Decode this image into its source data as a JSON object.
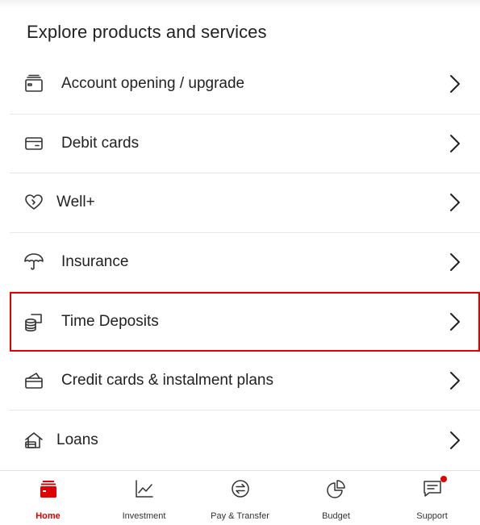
{
  "section": {
    "title": "Explore products and services"
  },
  "menu": {
    "items": [
      {
        "label": "Account opening / upgrade",
        "icon": "wallet-icon"
      },
      {
        "label": "Debit cards",
        "icon": "card-icon"
      },
      {
        "label": "Well+",
        "icon": "heart-icon"
      },
      {
        "label": "Insurance",
        "icon": "umbrella-icon"
      },
      {
        "label": "Time Deposits",
        "icon": "coins-icon",
        "highlighted": true
      },
      {
        "label": "Credit cards & instalment plans",
        "icon": "credit-card-stack-icon"
      },
      {
        "label": "Loans",
        "icon": "house-loan-icon"
      }
    ]
  },
  "nav": {
    "items": [
      {
        "label": "Home",
        "icon": "home-wallet-icon",
        "active": true
      },
      {
        "label": "Investment",
        "icon": "line-chart-icon"
      },
      {
        "label": "Pay & Transfer",
        "icon": "transfer-icon"
      },
      {
        "label": "Budget",
        "icon": "pie-chart-icon"
      },
      {
        "label": "Support",
        "icon": "chat-icon",
        "badge": true
      }
    ]
  },
  "colors": {
    "accent": "#e00000",
    "text": "#222222",
    "divider": "#e6e6e6"
  }
}
